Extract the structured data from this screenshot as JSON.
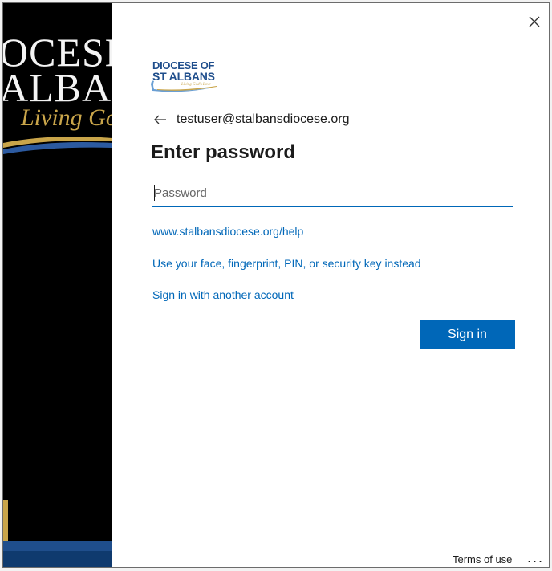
{
  "backdrop": {
    "word_line1": "OCESE",
    "word_line2": "ALBAN",
    "tagline": "Living God"
  },
  "logo": {
    "line1": "DIOCESE OF",
    "line2": "ST ALBANS",
    "tagline": "Living God's Love",
    "icon": "diocese-logo"
  },
  "dialog": {
    "close_icon": "close-icon",
    "back_icon": "back-arrow-icon",
    "identity": "testuser@stalbansdiocese.org",
    "title": "Enter password",
    "password": {
      "placeholder": "Password",
      "value": ""
    },
    "links": {
      "help": "www.stalbansdiocese.org/help",
      "security_key": "Use your face, fingerprint, PIN, or security key instead",
      "other_account": "Sign in with another account"
    },
    "signin_label": "Sign in"
  },
  "footer": {
    "terms": "Terms of use",
    "more": "..."
  },
  "colors": {
    "accent": "#0067b8",
    "brand_navy": "#1f4e8c",
    "brand_gold": "#c9a54a"
  }
}
